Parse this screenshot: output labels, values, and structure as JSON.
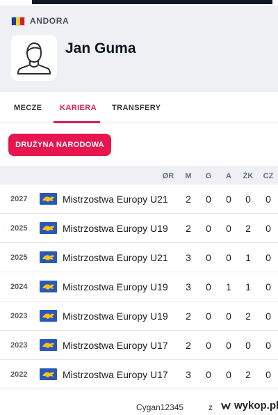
{
  "country": {
    "name": "ANDORA",
    "flag_colors": [
      "#1f3c99",
      "#f2d21b",
      "#d5202e"
    ]
  },
  "player": {
    "name": "Jan Guma",
    "avatar_icon": "person-placeholder-icon"
  },
  "tabs": [
    {
      "label": "MECZE",
      "active": false
    },
    {
      "label": "KARIERA",
      "active": true
    },
    {
      "label": "TRANSFERY",
      "active": false
    }
  ],
  "filter_button": {
    "label": "DRUŻYNA NARODOWA"
  },
  "table": {
    "headers": [
      "ØR",
      "M",
      "G",
      "A",
      "ŻK",
      "CZ"
    ],
    "rows": [
      {
        "year": "2027",
        "competition": "Mistrzostwa Europy U21",
        "stats": [
          "",
          "2",
          "0",
          "0",
          "0",
          "0"
        ]
      },
      {
        "year": "2025",
        "competition": "Mistrzostwa Europy U19",
        "stats": [
          "",
          "2",
          "0",
          "0",
          "2",
          "0"
        ]
      },
      {
        "year": "2025",
        "competition": "Mistrzostwa Europy U21",
        "stats": [
          "",
          "3",
          "0",
          "0",
          "1",
          "0"
        ]
      },
      {
        "year": "2024",
        "competition": "Mistrzostwa Europy U19",
        "stats": [
          "",
          "3",
          "0",
          "1",
          "1",
          "0"
        ]
      },
      {
        "year": "2023",
        "competition": "Mistrzostwa Europy U19",
        "stats": [
          "",
          "2",
          "0",
          "0",
          "2",
          "0"
        ]
      },
      {
        "year": "2023",
        "competition": "Mistrzostwa Europy U17",
        "stats": [
          "",
          "2",
          "0",
          "0",
          "0",
          "0"
        ]
      },
      {
        "year": "2022",
        "competition": "Mistrzostwa Europy U17",
        "stats": [
          "",
          "3",
          "0",
          "0",
          "2",
          "0"
        ]
      }
    ]
  },
  "footer": {
    "user": "Cygan12345",
    "separator": "z",
    "site": "wykop.pl"
  },
  "colors": {
    "accent": "#e8164e",
    "tab_active": "#d81e55"
  }
}
